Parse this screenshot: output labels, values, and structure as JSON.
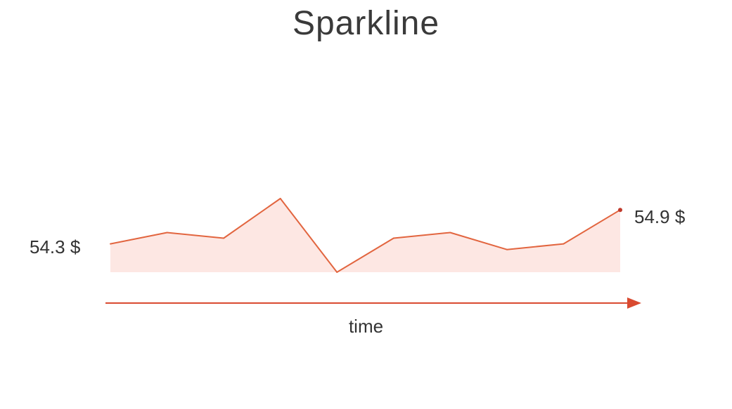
{
  "title": "Sparkline",
  "start_label": "54.3 $",
  "end_label": "54.9 $",
  "axis_label": "time",
  "colors": {
    "line": "#e2653f",
    "fill": "#fde7e3",
    "axis": "#d94a30",
    "end_point": "#c0392b"
  },
  "chart_data": {
    "type": "area",
    "title": "Sparkline",
    "xlabel": "time",
    "ylabel": "",
    "values": [
      54.3,
      54.5,
      54.4,
      55.1,
      53.8,
      54.4,
      54.5,
      54.2,
      54.3,
      54.9
    ],
    "start_value_label": "54.3 $",
    "end_value_label": "54.9 $",
    "ylim": [
      53.8,
      55.1
    ],
    "grid": false,
    "legend": "none"
  }
}
